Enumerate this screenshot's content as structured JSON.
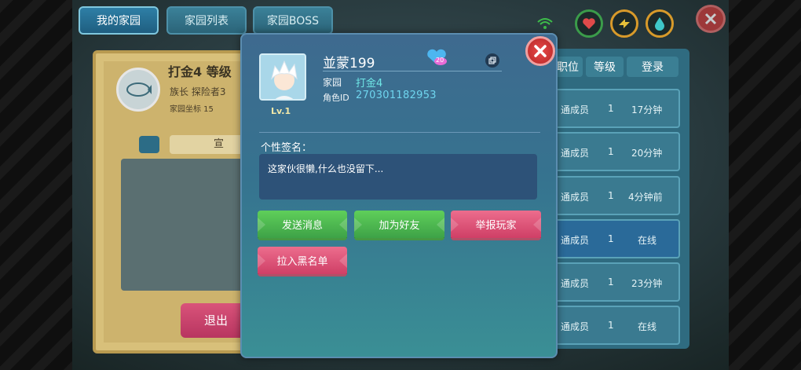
{
  "tabs": [
    {
      "label": "我的家园"
    },
    {
      "label": "家园列表"
    },
    {
      "label": "家园BOSS"
    }
  ],
  "home": {
    "name_partial": "打金4 等级",
    "leader_partial": "族长   探险者3",
    "coords_partial": "家园坐标 15",
    "notice_tab_partial": "宣",
    "exit_button_partial": "退出"
  },
  "member_list": {
    "headers": [
      "职位",
      "等级",
      "登录"
    ],
    "rows": [
      {
        "role": "通成员",
        "level": "1",
        "login": "17分钟"
      },
      {
        "role": "通成员",
        "level": "1",
        "login": "20分钟"
      },
      {
        "role": "通成员",
        "level": "1",
        "login": "4分钟前"
      },
      {
        "role": "通成员",
        "level": "1",
        "login": "在线"
      },
      {
        "role": "通成员",
        "level": "1",
        "login": "23分钟"
      },
      {
        "role": "通成员",
        "level": "1",
        "login": "在线"
      }
    ]
  },
  "profile": {
    "player_name": "並蒙199",
    "level_label": "Lv.1",
    "heart_badge_value": "20",
    "home_label": "家园",
    "home_value": "打金4",
    "role_id_label": "角色ID",
    "role_id_value": "270301182953",
    "signature_label": "个性签名：",
    "signature_text": "这家伙很懒,什么也没留下..."
  },
  "actions": {
    "send_message": "发送消息",
    "add_friend": "加为好友",
    "report_player": "举报玩家",
    "blacklist": "拉入黑名单"
  },
  "colors": {
    "accent_green": "#3ea247",
    "accent_pink": "#cf3f66",
    "id_cyan": "#6fd6ef",
    "close_red": "#d33a3a"
  }
}
